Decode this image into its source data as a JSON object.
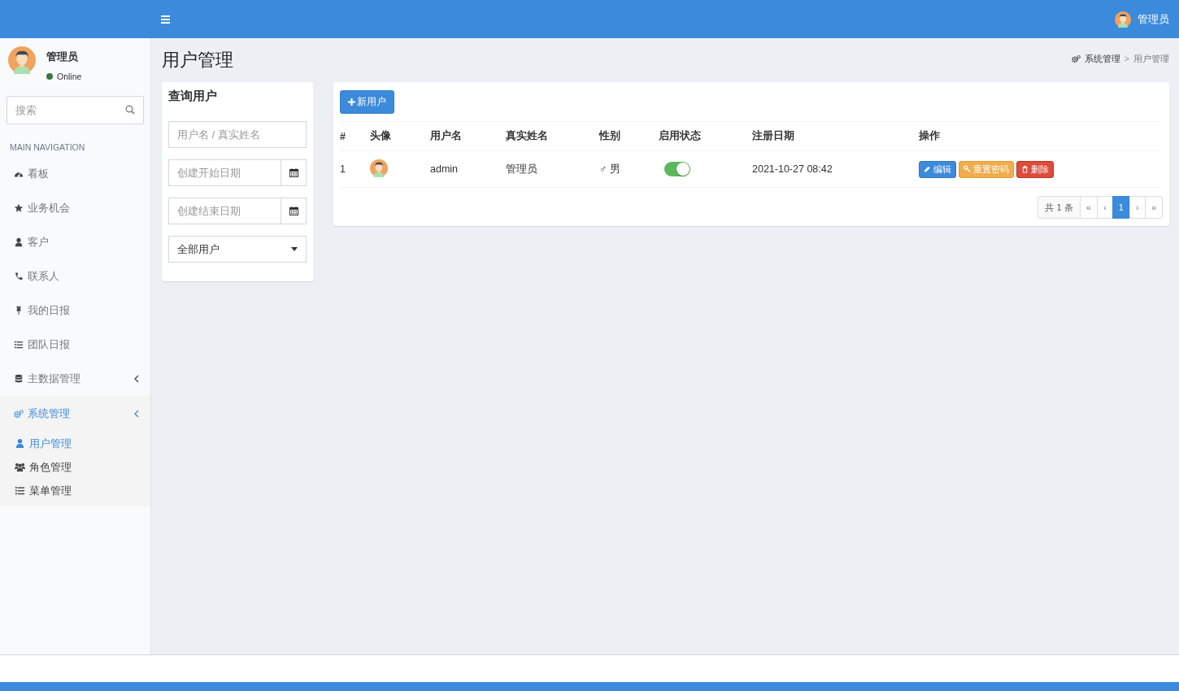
{
  "header": {
    "user_name": "管理员"
  },
  "sidebar": {
    "user": {
      "name": "管理员",
      "status": "Online"
    },
    "search": {
      "placeholder": "搜索"
    },
    "nav_heading": "MAIN NAVIGATION",
    "items": [
      {
        "label": "看板",
        "selected": false
      },
      {
        "label": "业务机会",
        "selected": false
      },
      {
        "label": "客户",
        "selected": false
      },
      {
        "label": "联系人",
        "selected": false
      },
      {
        "label": "我的日报",
        "selected": false
      },
      {
        "label": "团队日报",
        "selected": false
      },
      {
        "label": "主数据管理",
        "selected": false,
        "expanded": false
      },
      {
        "label": "系统管理",
        "selected": true,
        "expanded": true,
        "children": [
          {
            "label": "用户管理",
            "selected": true
          },
          {
            "label": "角色管理",
            "selected": false
          },
          {
            "label": "菜单管理",
            "selected": false
          }
        ]
      }
    ]
  },
  "page_title": "用户管理",
  "breadcrumb": {
    "items": [
      "系统管理",
      "用户管理"
    ],
    "separator": ">"
  },
  "query_panel": {
    "title": "查询用户",
    "keyword": {
      "placeholder": "用户名 / 真实姓名"
    },
    "start_date": {
      "placeholder": "创建开始日期"
    },
    "end_date": {
      "placeholder": "创建结束日期"
    },
    "user_filter": {
      "value": "全部用户"
    }
  },
  "users_panel": {
    "add_button": "新用户",
    "columns": [
      "#",
      "头像",
      "用户名",
      "真实姓名",
      "性别",
      "启用状态",
      "注册日期",
      "操作"
    ],
    "rows": [
      {
        "index": "1",
        "username": "admin",
        "real_name": "管理员",
        "gender_symbol": "♂",
        "gender": "男",
        "enabled": true,
        "registered": "2021-10-27 08:42",
        "actions": [
          {
            "kind": "edit",
            "label": "编辑"
          },
          {
            "kind": "reset",
            "label": "重置密码"
          },
          {
            "kind": "delete",
            "label": "删除"
          }
        ]
      }
    ],
    "pagination": {
      "total": "共 1 条",
      "first": "«",
      "prev": "‹",
      "pages": [
        {
          "label": "1",
          "selected": true
        }
      ],
      "next": "›",
      "last": "»"
    }
  }
}
